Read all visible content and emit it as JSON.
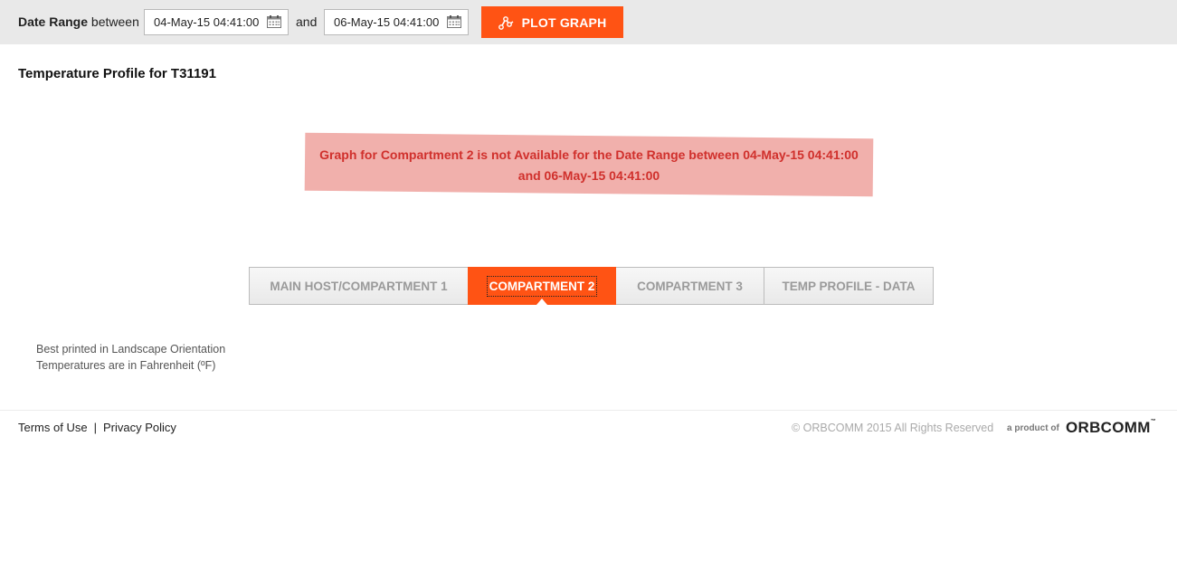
{
  "toolbar": {
    "date_range_label": "Date Range",
    "between_label": "between",
    "start_date": "04-May-15 04:41:00",
    "and_label": "and",
    "end_date": "06-May-15 04:41:00",
    "plot_button_label": "PLOT GRAPH",
    "accent_color": "#ff5314"
  },
  "page": {
    "title": "Temperature Profile for T31191"
  },
  "alert": {
    "line1": "Graph for Compartment 2 is not Available for the Date Range between 04-May-15 04:41:00",
    "line2": "and 06-May-15 04:41:00"
  },
  "tabs": [
    {
      "label": "MAIN HOST/COMPARTMENT 1",
      "active": false
    },
    {
      "label": "COMPARTMENT 2",
      "active": true
    },
    {
      "label": "COMPARTMENT 3",
      "active": false
    },
    {
      "label": "TEMP PROFILE - DATA",
      "active": false
    }
  ],
  "notes": {
    "line1": "Best printed in Landscape Orientation",
    "line2": "Temperatures are in Fahrenheit (ºF)"
  },
  "footer": {
    "terms": "Terms of Use",
    "separator": "|",
    "privacy": "Privacy Policy",
    "copyright": "© ORBCOMM 2015 All Rights Reserved",
    "product_of": "a product of",
    "logo": "ORBCOMM",
    "trademark": "™"
  }
}
